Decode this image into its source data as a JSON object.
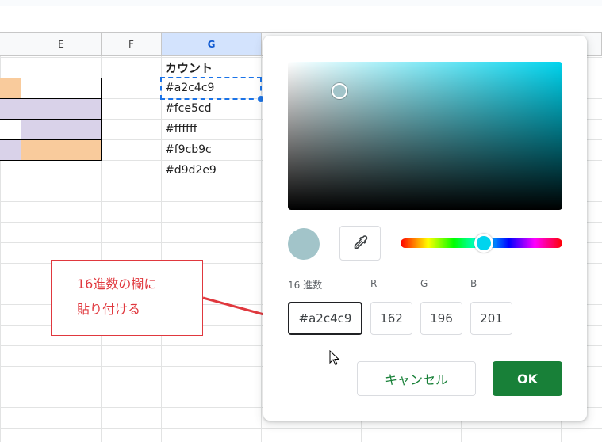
{
  "sheet": {
    "columns": [
      "E",
      "F",
      "G"
    ],
    "selected_column": "G",
    "header_cell": "カウント",
    "values": [
      "#a2c4c9",
      "#fce5cd",
      "#ffffff",
      "#f9cb9c",
      "#d9d2e9"
    ],
    "colors": {
      "peach": "#f9cb9c",
      "lavender": "#d9d2e9",
      "white": "#ffffff",
      "selection": "#1a73e8"
    }
  },
  "callout": {
    "line1": "16進数の欄に",
    "line2": "貼り付ける",
    "color": "#e0383e"
  },
  "picker": {
    "selected_color": "#a2c4c9",
    "hue_color": "#00d4ee",
    "eyedropper_icon": "eyedropper-icon",
    "hex_label": "16 進数",
    "hex_value": "#a2c4c9",
    "r_label": "R",
    "r_value": "162",
    "g_label": "G",
    "g_value": "196",
    "b_label": "B",
    "b_value": "201",
    "cancel_label": "キャンセル",
    "ok_label": "OK",
    "ok_color": "#188038"
  }
}
